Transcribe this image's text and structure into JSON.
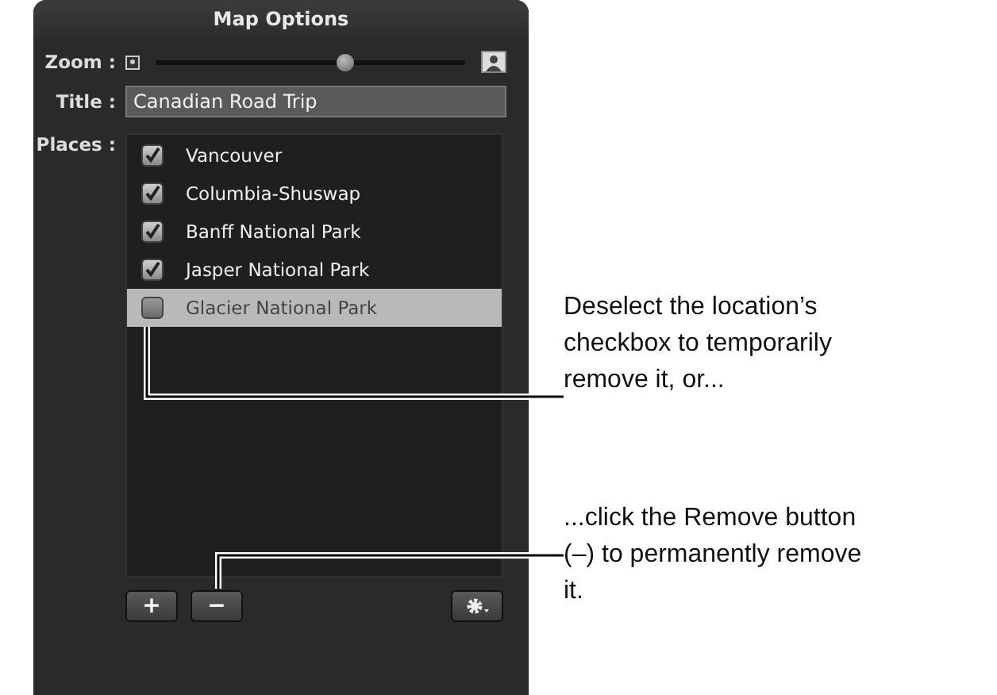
{
  "panel": {
    "title": "Map Options",
    "zoom": {
      "label": "Zoom :",
      "level": 0.61
    },
    "title_field": {
      "label": "Title :",
      "value": "Canadian Road Trip"
    },
    "places": {
      "label": "Places :",
      "items": [
        {
          "name": "Vancouver",
          "checked": true,
          "selected": false
        },
        {
          "name": "Columbia-Shuswap",
          "checked": true,
          "selected": false
        },
        {
          "name": "Banff National Park",
          "checked": true,
          "selected": false
        },
        {
          "name": "Jasper National Park",
          "checked": true,
          "selected": false
        },
        {
          "name": "Glacier National Park",
          "checked": false,
          "selected": true
        }
      ]
    },
    "buttons": [
      {
        "kind": "add",
        "label": "+"
      },
      {
        "kind": "remove",
        "label": "−"
      },
      {
        "kind": "gear"
      }
    ]
  },
  "callouts": [
    {
      "text": "Deselect the location’s checkbox to temporarily remove it, or..."
    },
    {
      "text": "...click the Remove button (–) to permanently remove it."
    }
  ]
}
